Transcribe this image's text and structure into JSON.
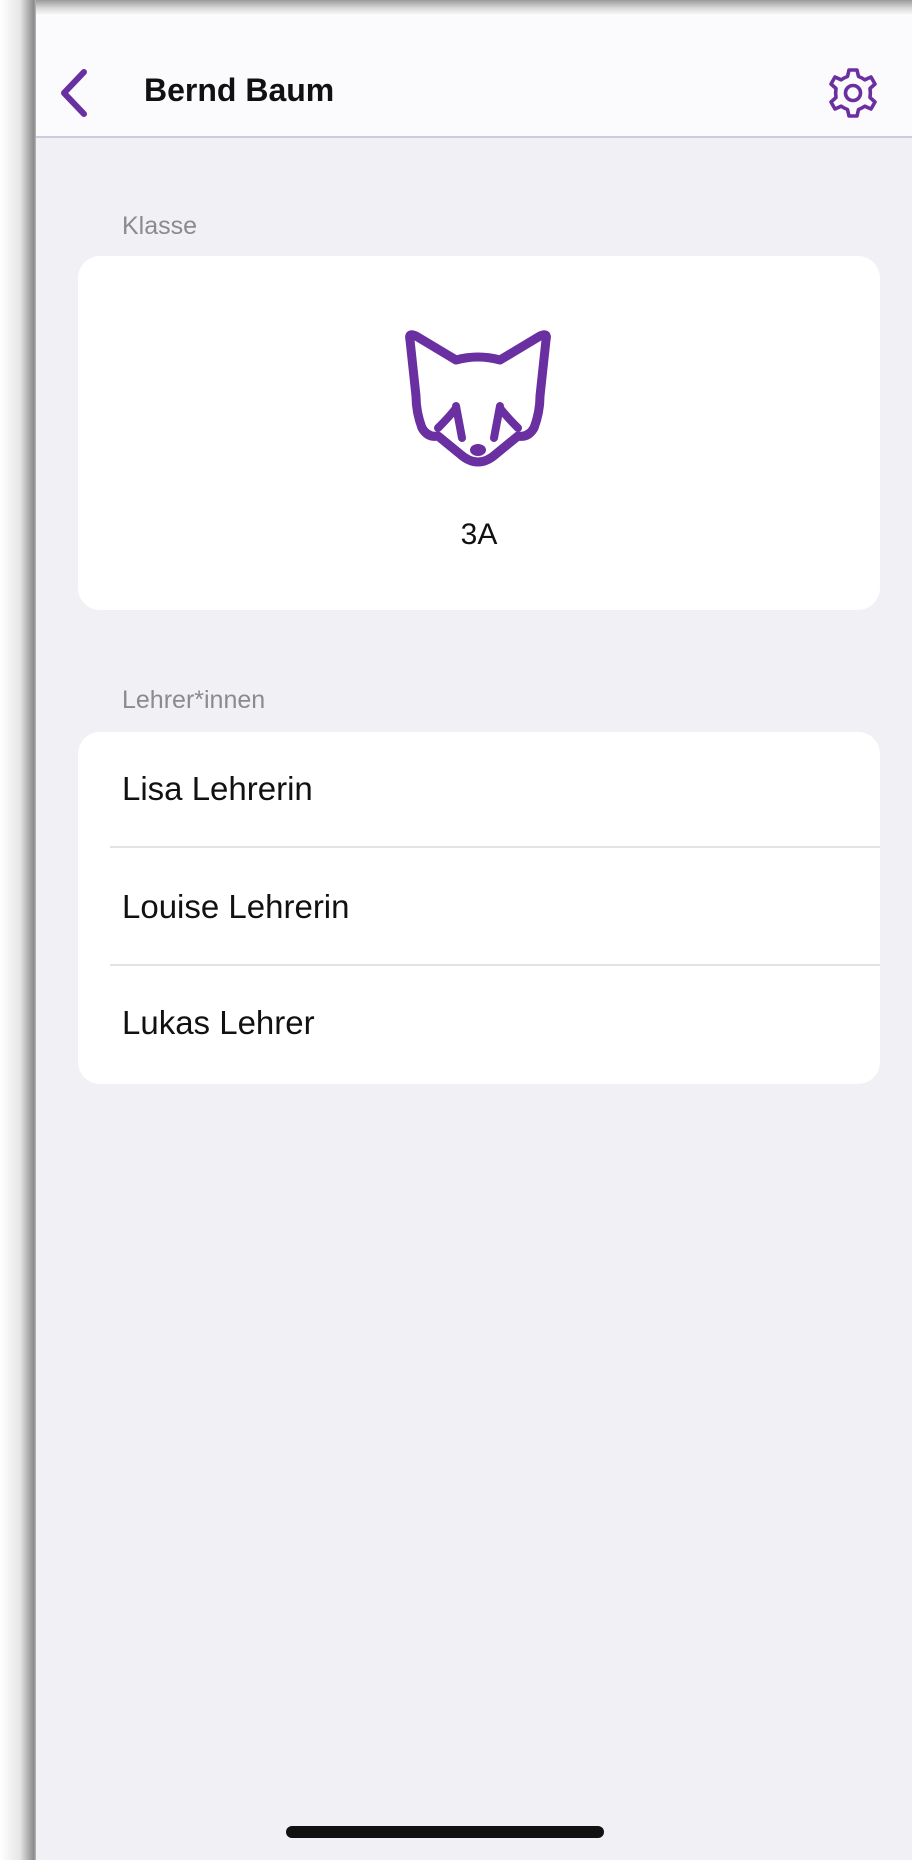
{
  "navbar": {
    "title": "Bernd Baum",
    "back_icon": "chevron-left-icon",
    "settings_icon": "gear-icon"
  },
  "class_section": {
    "header": "Klasse",
    "icon": "fox-icon",
    "name": "3A"
  },
  "teachers_section": {
    "header": "Lehrer*innen",
    "items": [
      {
        "label": "Lisa Lehrerin"
      },
      {
        "label": "Louise Lehrerin"
      },
      {
        "label": "Lukas Lehrer"
      }
    ]
  },
  "colors": {
    "accent": "#6a2fa0",
    "background": "#f1f0f5",
    "card": "#ffffff",
    "secondary_text": "#8a8a8f"
  }
}
